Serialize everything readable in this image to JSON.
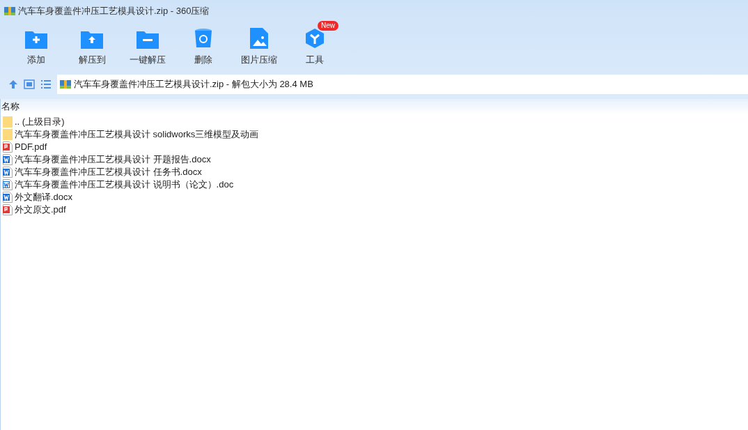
{
  "window": {
    "title": "汽车车身覆盖件冲压工艺模具设计.zip - 360压缩"
  },
  "toolbar": [
    {
      "kind": "add",
      "label": "添加"
    },
    {
      "kind": "extract_to",
      "label": "解压到"
    },
    {
      "kind": "extract",
      "label": "一键解压"
    },
    {
      "kind": "delete",
      "label": "删除"
    },
    {
      "kind": "image",
      "label": "图片压缩"
    },
    {
      "kind": "tools",
      "label": "工具",
      "badge": "New"
    }
  ],
  "address": {
    "path": "汽车车身覆盖件冲压工艺模具设计.zip - 解包大小为 28.4 MB"
  },
  "table": {
    "columns": [
      "名称"
    ],
    "rows": [
      {
        "kind": "folder",
        "name": ".. (上级目录)"
      },
      {
        "kind": "folder",
        "name": "汽车车身覆盖件冲压工艺模具设计 solidworks三维模型及动画"
      },
      {
        "kind": "pdf",
        "name": "PDF.pdf"
      },
      {
        "kind": "docx",
        "name": "汽车车身覆盖件冲压工艺模具设计 开题报告.docx"
      },
      {
        "kind": "docx",
        "name": "汽车车身覆盖件冲压工艺模具设计 任务书.docx"
      },
      {
        "kind": "doc",
        "name": "汽车车身覆盖件冲压工艺模具设计 说明书（论文）.doc"
      },
      {
        "kind": "docx",
        "name": "外文翻译.docx"
      },
      {
        "kind": "pdf",
        "name": "外文原文.pdf"
      }
    ]
  }
}
